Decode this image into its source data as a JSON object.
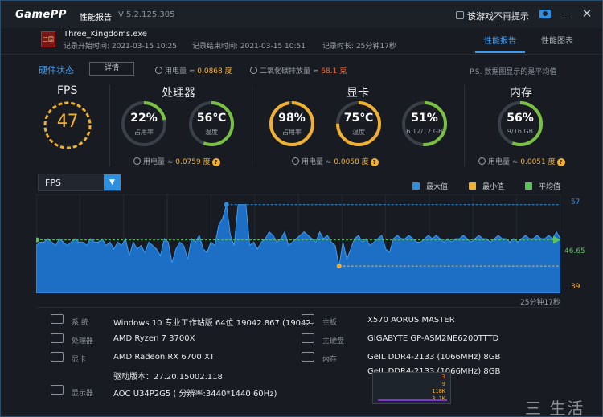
{
  "titlebar": {
    "logo": "GamePP",
    "title": "性能报告",
    "version": "V 5.2.125.305",
    "dont_show_label": "该游戏不再提示"
  },
  "session": {
    "app_icon_text": "三国",
    "process": "Three_Kingdoms.exe",
    "start": "记录开始时间: 2021-03-15 10:25",
    "end": "记录结束时间: 2021-03-15 10:51",
    "duration": "记录时长: 25分钟17秒"
  },
  "tabs": [
    "性能报告",
    "性能图表"
  ],
  "hardware": {
    "title": "硬件状态",
    "detail_button": "详情",
    "total_power_label": "用电量 ≈ ",
    "total_power": "0.0868 度",
    "co2_label": "二氧化碳排放量 ≈ ",
    "co2": "68.1 克",
    "note": "P.S. 数据图显示的是平均值"
  },
  "groups": {
    "fps": {
      "title": "FPS",
      "value": "47"
    },
    "cpu": {
      "title": "处理器",
      "usage": "22%",
      "usage_label": "占用率",
      "usage_pct": 22,
      "temp": "56℃",
      "temp_label": "温度",
      "temp_pct": 56,
      "power_label": "用电量 ≈ ",
      "power": "0.0759 度"
    },
    "gpu": {
      "title": "显卡",
      "usage": "98%",
      "usage_label": "占用率",
      "usage_pct": 98,
      "temp": "75℃",
      "temp_label": "温度",
      "temp_pct": 75,
      "vram": "51%",
      "vram_label": "6.12/12 GB",
      "vram_pct": 51,
      "power_label": "用电量 ≈ ",
      "power": "0.0058 度"
    },
    "mem": {
      "title": "内存",
      "usage": "56%",
      "usage_label": "9/16 GB",
      "usage_pct": 56,
      "power_label": "用电量 ≈ ",
      "power": "0.0051 度"
    }
  },
  "colors": {
    "accent": "#3d9bf0",
    "fps_ring": "#f0b132",
    "gauge_green": "#7ac143",
    "gauge_orange": "#f0b132",
    "gauge_track": "#3a4048"
  },
  "chart_controls": {
    "selected": "FPS",
    "legend": [
      {
        "label": "最大值",
        "color": "#2e8fe0"
      },
      {
        "label": "最小值",
        "color": "#f0b132"
      },
      {
        "label": "平均值",
        "color": "#5cc25a"
      }
    ]
  },
  "chart_data": {
    "type": "area",
    "title": "FPS",
    "max": 57,
    "min": 39,
    "avg": 46.65,
    "max_label": "57",
    "min_label": "39",
    "avg_label": "46.65",
    "duration_label": "25分钟17秒",
    "ylim": [
      31,
      60
    ],
    "values": [
      45,
      46,
      46,
      47,
      46,
      45,
      47,
      46,
      45,
      46,
      47,
      46,
      46,
      45,
      47,
      46,
      46,
      47,
      45,
      46,
      44,
      46,
      45,
      47,
      42,
      46,
      44,
      45,
      43,
      46,
      45,
      44,
      42,
      47,
      46,
      40,
      44,
      46,
      45,
      41,
      47,
      46,
      48,
      44,
      43,
      46,
      45,
      51,
      53,
      57,
      48,
      45,
      57,
      57,
      57,
      45,
      46,
      44,
      46,
      47,
      49,
      48,
      46,
      47,
      49,
      45,
      46,
      47,
      48,
      49,
      48,
      47,
      46,
      49,
      47,
      48,
      46,
      45,
      39,
      46,
      41,
      44,
      47,
      48,
      46,
      47,
      45,
      46,
      47,
      48,
      44,
      43,
      47,
      48,
      47,
      47,
      48,
      47,
      46,
      46,
      47,
      48,
      47,
      48,
      47,
      46,
      47,
      46,
      47,
      47,
      48,
      47,
      46,
      47,
      48,
      47,
      47,
      46,
      47,
      48,
      47,
      47,
      46,
      47,
      46,
      47,
      48,
      47,
      47,
      48,
      47,
      47,
      48,
      47,
      49,
      47
    ]
  },
  "system": {
    "os_label": "系 统",
    "os": "Windows 10 专业工作站版 64位   19042.867 (19042.",
    "cpu_label": "处理器",
    "cpu": "AMD Ryzen 7 3700X",
    "gpu_label": "显卡",
    "gpu": "AMD Radeon RX 6700 XT",
    "driver": "驱动版本：27.20.15002.118",
    "display_label": "显示器",
    "display": "AOC U34P2G5 ( 分辨率:3440*1440 60Hz)",
    "mb_label": "主板",
    "mb": "X570 AORUS MASTER",
    "disk_label": "主硬盘",
    "disk": "GIGABYTE GP-ASM2NE6200TTTD",
    "ram_label": "内存",
    "ram1": "GeIL DDR4-2133 (1066MHz) 8GB",
    "ram2": "GeIL DDR4-2133 (1066MHz) 8GB"
  },
  "overlay": {
    "n1": "3",
    "n2": "9",
    "n3": "118K",
    "n4": "3.1K"
  },
  "watermark": "三 生活"
}
